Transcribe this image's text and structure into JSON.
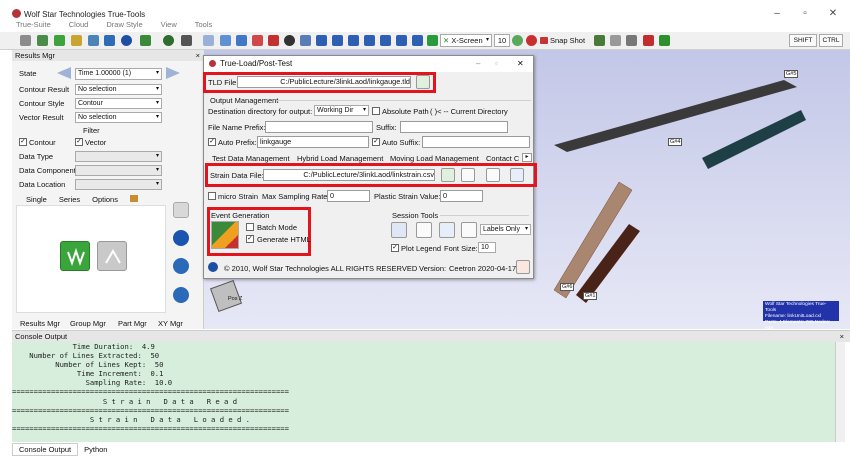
{
  "app": {
    "title": "Wolf Star Technologies True-Tools",
    "menu": [
      "True-Suite",
      "Cloud",
      "Draw Style",
      "View",
      "Tools"
    ]
  },
  "toolbar": {
    "xscreen_label": "X-Screen",
    "zoom_value": "10",
    "snapshot_label": "Snap Shot",
    "shift_label": "SHIFT",
    "ctrl_label": "CTRL"
  },
  "results_mgr": {
    "title": "Results Mgr",
    "state_label": "State",
    "state_value": "Time 1.00000 (1)",
    "contour_result_label": "Contour Result",
    "contour_result_value": "No selection",
    "contour_style_label": "Contour Style",
    "contour_style_value": "Contour",
    "vector_result_label": "Vector Result",
    "vector_result_value": "No selection",
    "filter_label": "Filter",
    "contour_chk": "Contour",
    "vector_chk": "Vector",
    "data_type_label": "Data Type",
    "data_component_label": "Data Component",
    "data_location_label": "Data Location",
    "tabs": [
      "Single",
      "Series",
      "Options"
    ]
  },
  "bottom_tabs": [
    "Results Mgr",
    "Group Mgr",
    "Part Mgr",
    "XY Mgr"
  ],
  "console": {
    "title": "Console Output",
    "lines": [
      "              Time Duration:  4.9",
      "    Number of Lines Extracted:  50",
      "          Number of Lines Kept:  50",
      "               Time Increment:  0.1",
      "                 Sampling Rate:  10.0",
      "================================================================",
      "                     S t r a i n   D a t a   R e a d",
      "================================================================",
      "                  S t r a i n   D a t a   L o a d e d .",
      "================================================================"
    ],
    "tabs": [
      "Console Output",
      "Python"
    ]
  },
  "dialog": {
    "title": "True-Load/Post-Test",
    "tld_file_label": "TLD File:",
    "tld_file_value": "C:/PublicLecture/3linkLaod/linkgauge.tld",
    "output_mgmt_label": "Output Management",
    "dest_label": "Destination directory for output:",
    "dest_value": "Working Dir",
    "absolute_path_label": "Absolute Path",
    "current_dir_label": "( )< -- Current Directory",
    "file_name_prefix_label": "File Name Prefix:",
    "suffix_label": "Suffix:",
    "auto_prefix_label": "Auto Prefix:",
    "auto_prefix_value": "linkgauge",
    "auto_suffix_label": "Auto Suffix:",
    "tabs": [
      "Test Data Management",
      "Hybrid Load Management",
      "Moving Load Management",
      "Contact C"
    ],
    "strain_file_label": "Strain Data File:",
    "strain_file_value": "C:/PublicLecture/3linkLaod/linkstrain.csv",
    "micro_strain_label": "micro Strain",
    "max_sampling_label": "Max Sampling Rate:",
    "max_sampling_value": "0",
    "plastic_strain_label": "Plastic Strain Value:",
    "plastic_strain_value": "0",
    "event_gen_label": "Event Generation",
    "batch_mode_label": "Batch Mode",
    "generate_html_label": "Generate HTML",
    "session_tools_label": "Session Tools",
    "labels_only_value": "Labels Only",
    "plot_legend_label": "Plot Legend",
    "font_size_label": "Font Size:",
    "font_size_value": "10",
    "copyright": "© 2010, Wolf Star Technologies  ALL RIGHTS RESERVED",
    "version_label": "Version:",
    "version_value": "Ceetron 2020-04-17"
  },
  "viewport": {
    "gauges": [
      "G#5",
      "G#4",
      "G#6",
      "G#1"
    ],
    "cube_label": "Pos Z",
    "info": [
      "Wolf Star Technologies True-Tools",
      "Filename: linkUnitLoad.cxl",
      "Parts: 4  Elements: 786  Nodes: 938"
    ]
  }
}
